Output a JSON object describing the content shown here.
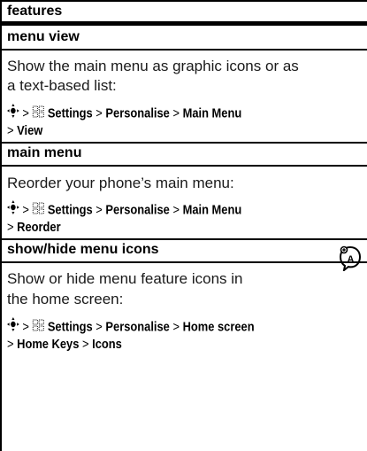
{
  "section_title": "features",
  "features": [
    {
      "title": "menu view",
      "description_lines": [
        "Show the main menu as graphic icons or as",
        "a text-based list:"
      ],
      "path_line1": [
        "Settings",
        "Personalise",
        "Main Menu"
      ],
      "path_line2": [
        "View"
      ]
    },
    {
      "title": "main menu",
      "description_lines": [
        "Reorder your phone’s main menu:"
      ],
      "path_line1": [
        "Settings",
        "Personalise",
        "Main Menu"
      ],
      "path_line2": [
        "Reorder"
      ]
    },
    {
      "title": "show/hide menu icons",
      "description_lines": [
        "Show or hide menu feature icons in",
        "the home screen:"
      ],
      "path_line1": [
        "Settings",
        "Personalise",
        "Home screen"
      ],
      "path_line2": [
        "Home Keys",
        "Icons"
      ]
    }
  ],
  "separator": ">",
  "icons": {
    "nav_key": "nav-key-icon",
    "settings": "settings-icon",
    "network_feature": "network-feature-icon"
  }
}
